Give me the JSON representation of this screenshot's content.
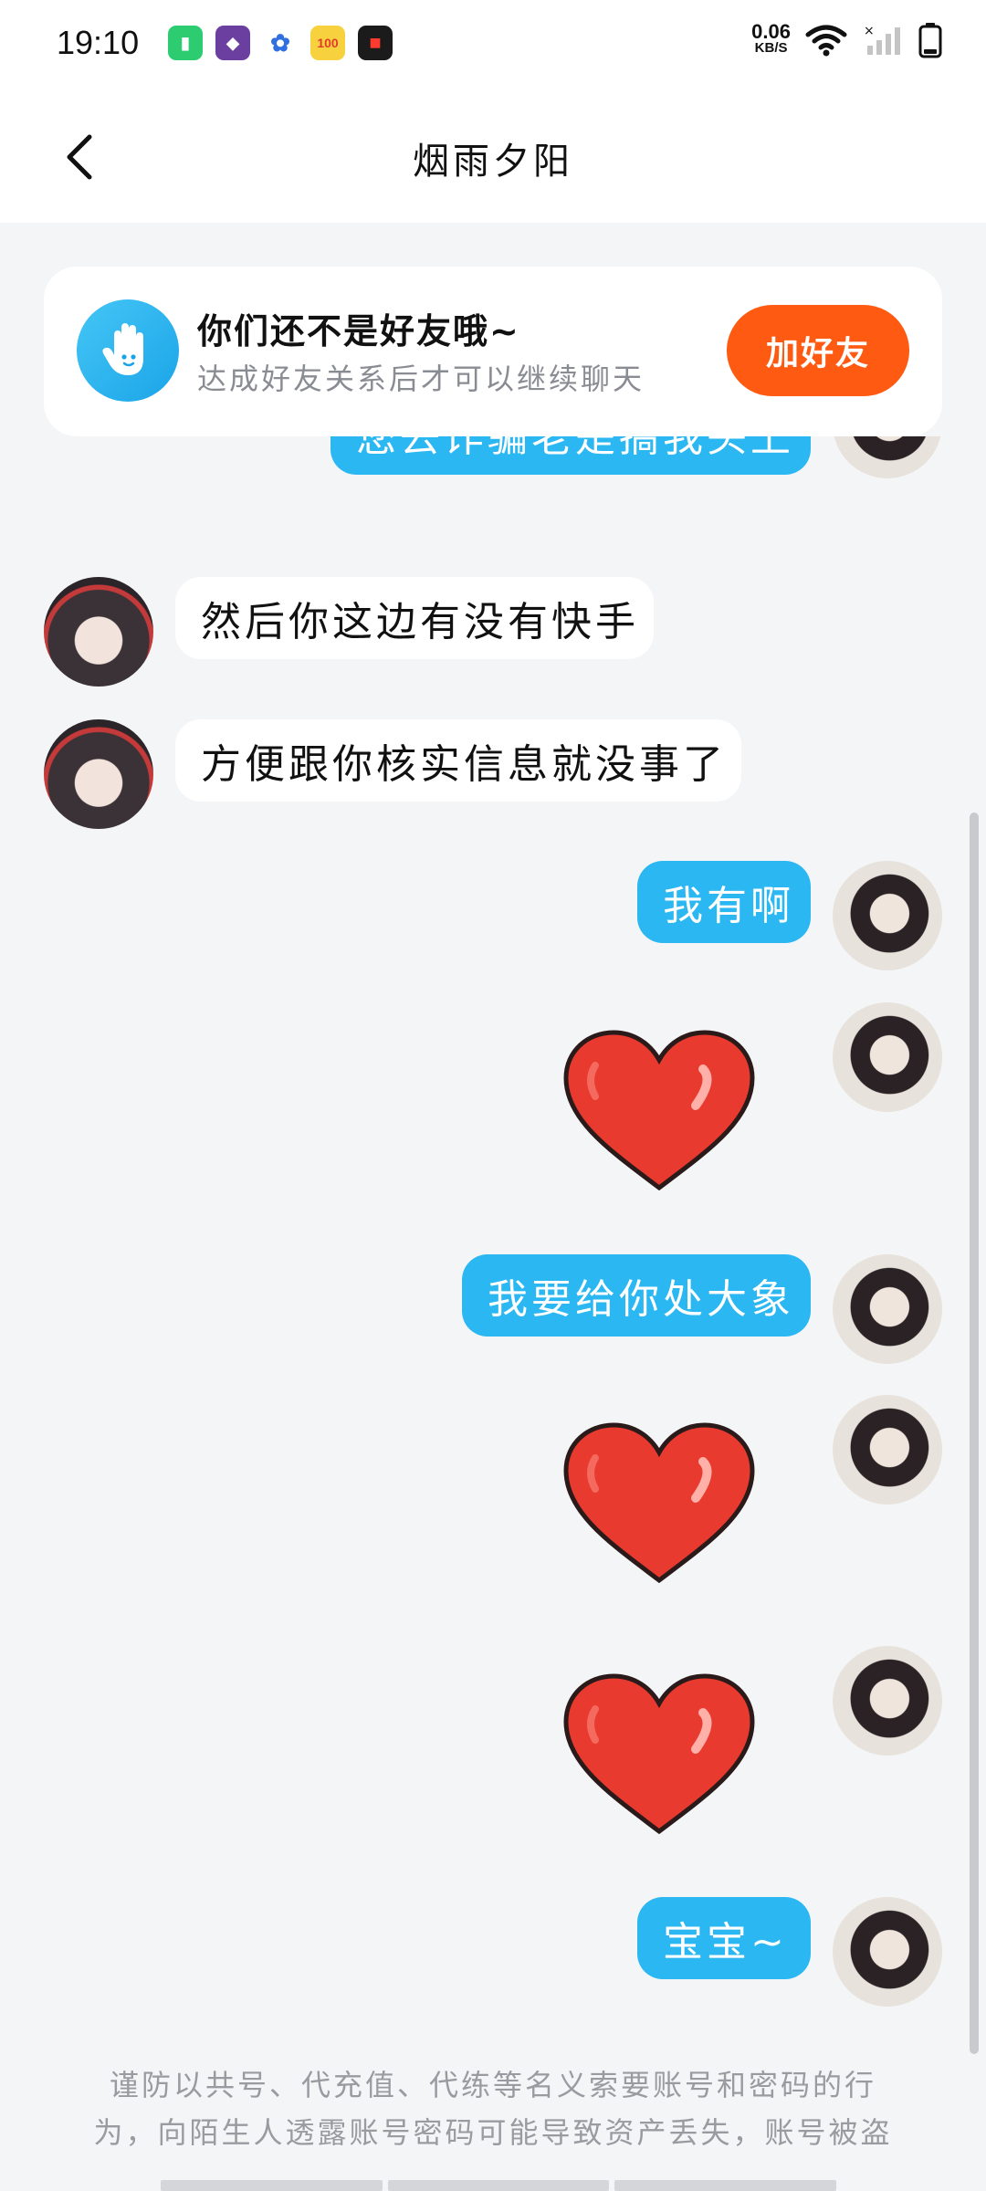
{
  "status_bar": {
    "time": "19:10",
    "net_speed_value": "0.06",
    "net_speed_unit": "KB/S",
    "app_icons": [
      "battery-app-icon",
      "game-app-icon",
      "baidu-paw-icon",
      "score-100-icon",
      "video-recorder-icon"
    ]
  },
  "header": {
    "title": "烟雨夕阳"
  },
  "friend_notice": {
    "title": "你们还不是好友哦~",
    "subtitle": "达成好友关系后才可以继续聊天",
    "button": "加好友",
    "button_color": "#ff5a12"
  },
  "messages": [
    {
      "side": "right",
      "type": "text",
      "text": "您去诈骗老是搞我头上"
    },
    {
      "side": "left",
      "type": "text",
      "text": "然后你这边有没有快手"
    },
    {
      "side": "left",
      "type": "text",
      "text": "方便跟你核实信息就没事了"
    },
    {
      "side": "right",
      "type": "text",
      "text": "我有啊"
    },
    {
      "side": "right",
      "type": "sticker",
      "sticker": "heart-icon"
    },
    {
      "side": "right",
      "type": "text",
      "text": "我要给你处大象"
    },
    {
      "side": "right",
      "type": "sticker",
      "sticker": "heart-icon"
    },
    {
      "side": "right",
      "type": "sticker",
      "sticker": "heart-icon"
    },
    {
      "side": "right",
      "type": "text",
      "text": "宝宝~"
    }
  ],
  "warning": {
    "line1": "谨防以共号、代充值、代练等名义索要账号和密码的行",
    "line2": "为，向陌生人透露账号密码可能导致资产丢失，账号被盗"
  },
  "colors": {
    "accent_blue": "#2bb7f2",
    "background": "#f4f5f7"
  }
}
